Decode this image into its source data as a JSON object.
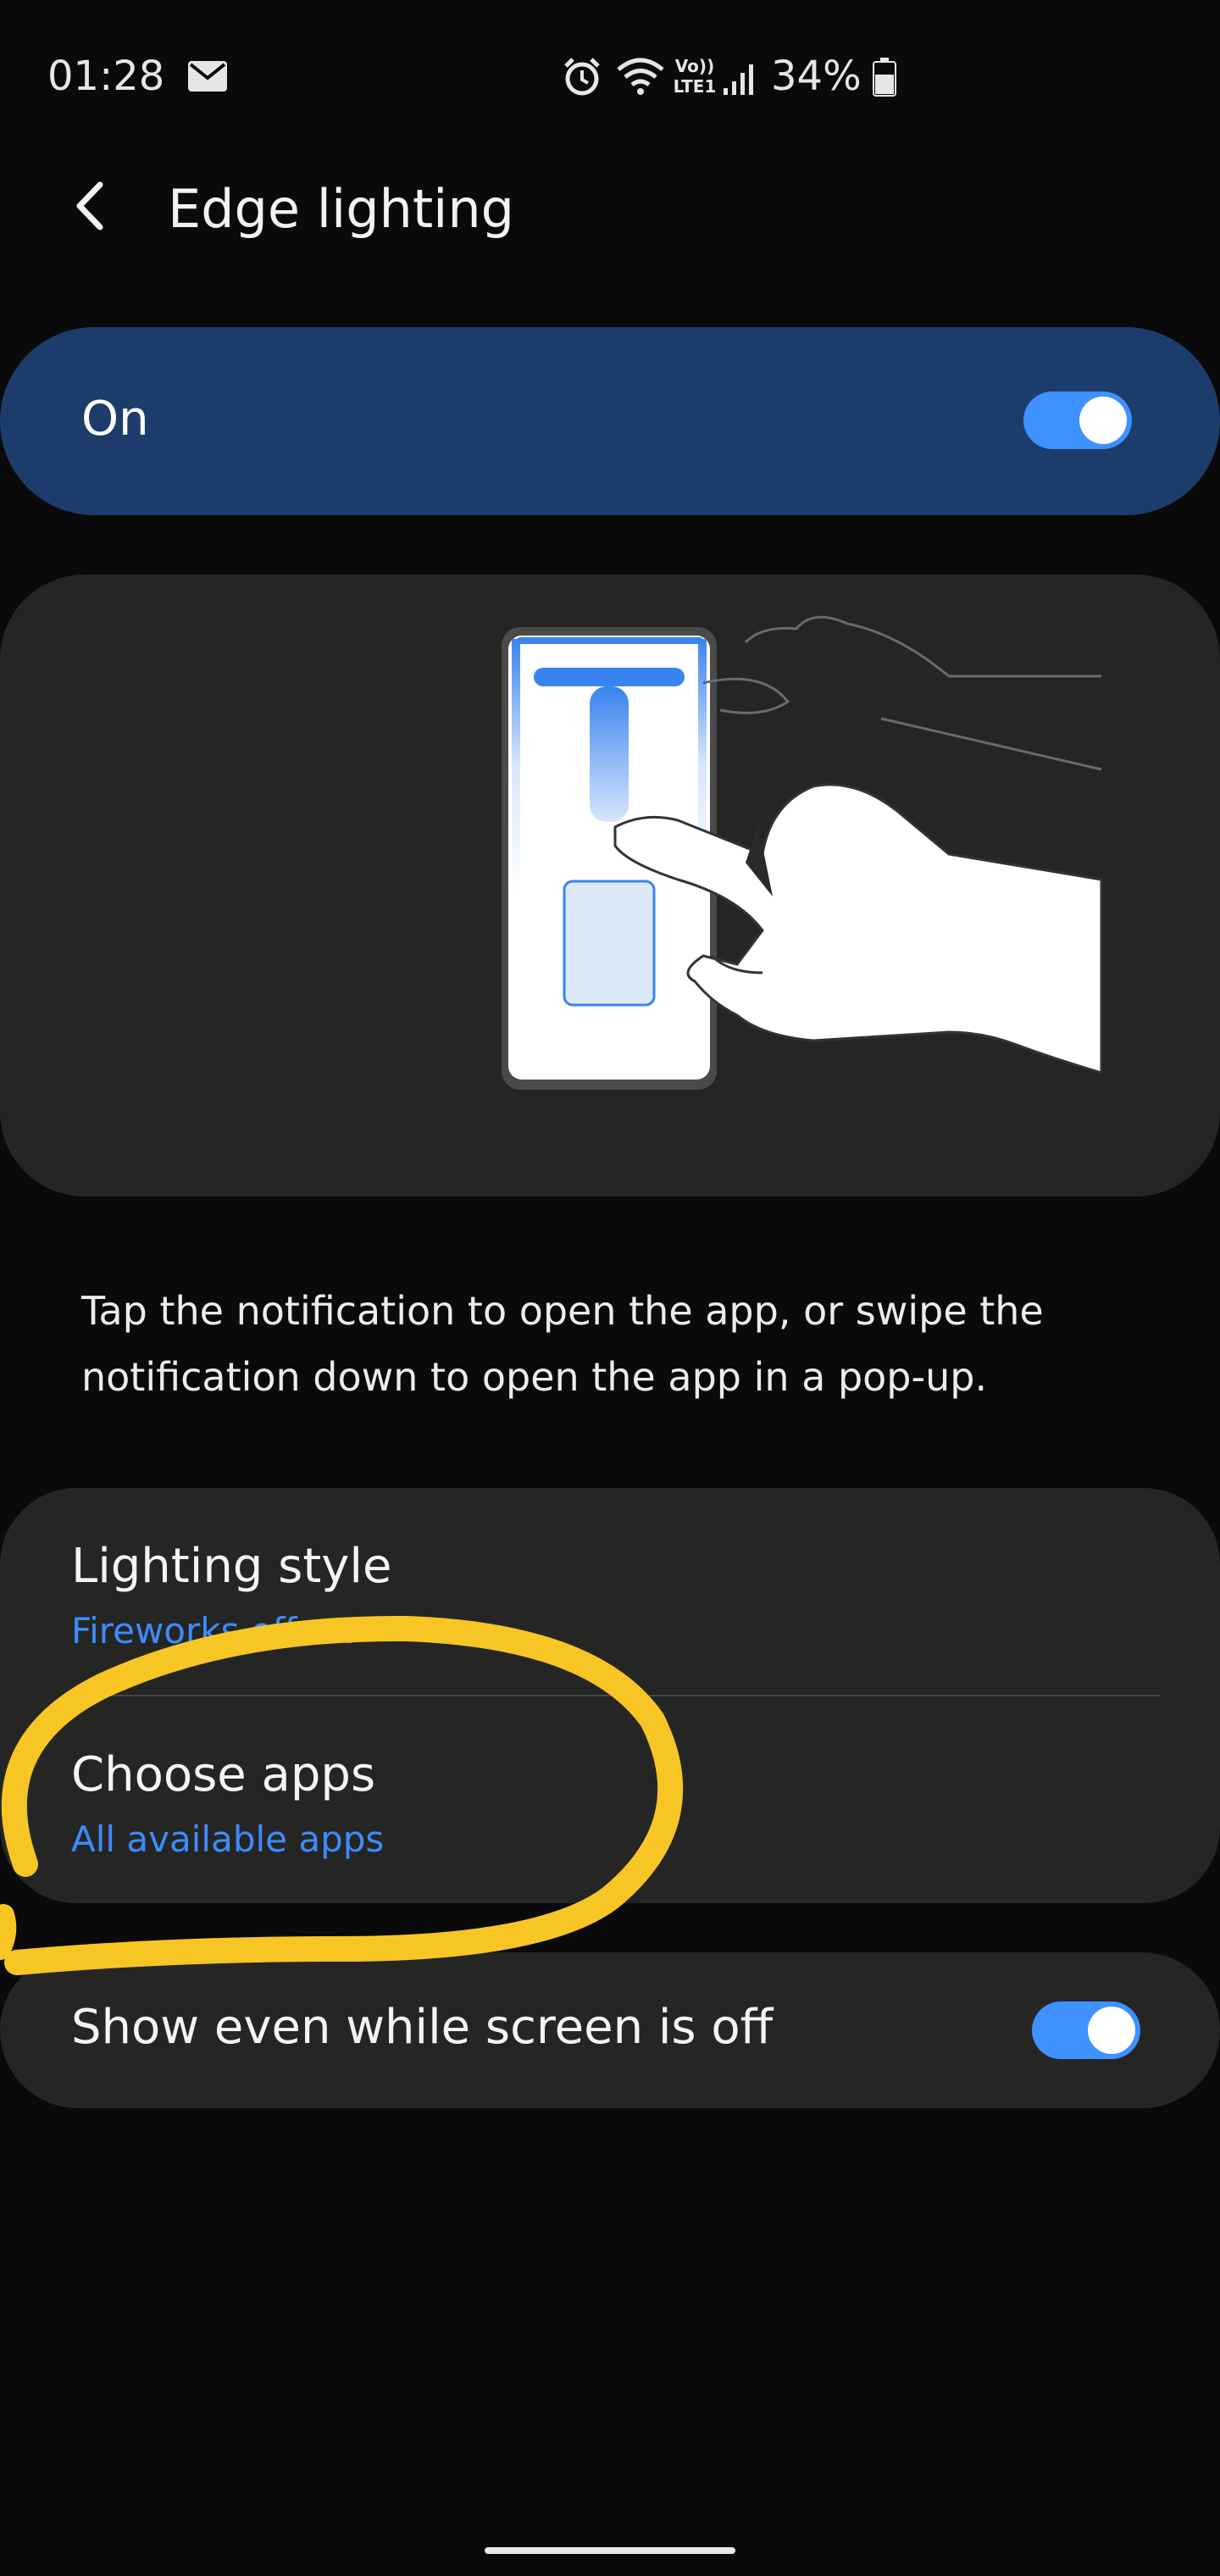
{
  "status_bar": {
    "time": "01:28",
    "battery": "34%",
    "network_label": "Vo)) LTE1",
    "icons": [
      "mail-icon",
      "alarm-icon",
      "wifi-icon",
      "volte-icon",
      "signal-icon",
      "battery-icon"
    ]
  },
  "header": {
    "back_icon": "back-arrow-icon",
    "title": "Edge lighting"
  },
  "master_switch": {
    "label": "On",
    "enabled": true
  },
  "illustration": {
    "description": "Tap the notification to open the app, or swipe the notification down to open the app in a pop-up."
  },
  "settings": {
    "lighting_style": {
      "title": "Lighting style",
      "value": "Fireworks effect"
    },
    "choose_apps": {
      "title": "Choose apps",
      "value": "All available apps"
    },
    "screen_off": {
      "title": "Show even while screen is off",
      "enabled": true
    }
  },
  "colors": {
    "background": "#0a0a0a",
    "card": "#252624",
    "master_card": "#1c3d6b",
    "accent": "#3e91ff",
    "subtitle": "#3d8bff",
    "annotation": "#f7c624"
  }
}
